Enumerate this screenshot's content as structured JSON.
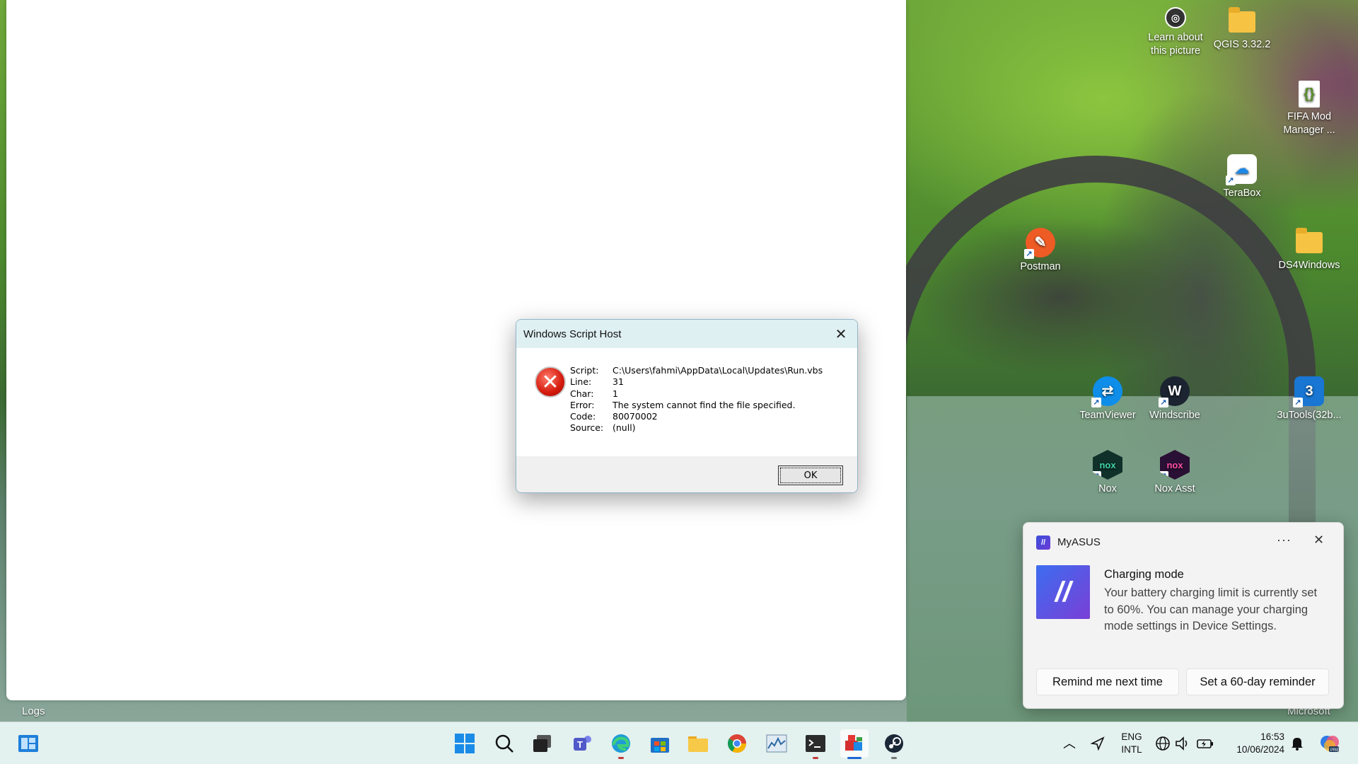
{
  "app_window": {
    "bottom_label": "Logs",
    "right_label": "Microsoft"
  },
  "desktop_icons": [
    {
      "label": "Learn about this picture",
      "icon": "camera-icon"
    },
    {
      "label": "QGIS 3.32.2",
      "icon": "folder-icon"
    },
    {
      "label": "FIFA Mod Manager ...",
      "icon": "json-file-icon"
    },
    {
      "label": "TeraBox",
      "icon": "cloud-icon"
    },
    {
      "label": "Postman",
      "icon": "postman-icon"
    },
    {
      "label": "DS4Windows",
      "icon": "folder-icon"
    },
    {
      "label": "TeamViewer",
      "icon": "teamviewer-icon"
    },
    {
      "label": "Windscribe",
      "icon": "windscribe-icon"
    },
    {
      "label": "3uTools(32b...",
      "icon": "3utools-icon"
    },
    {
      "label": "Nox",
      "icon": "nox-icon"
    },
    {
      "label": "Nox Asst",
      "icon": "nox-icon"
    }
  ],
  "dialog": {
    "title": "Windows Script Host",
    "rows": [
      {
        "key": "Script:",
        "value": "C:\\Users\\fahmi\\AppData\\Local\\Updates\\Run.vbs"
      },
      {
        "key": "Line:",
        "value": "31"
      },
      {
        "key": "Char:",
        "value": "1"
      },
      {
        "key": "Error:",
        "value": "The system cannot find the file specified."
      },
      {
        "key": "Code:",
        "value": "80070002"
      },
      {
        "key": "Source:",
        "value": "(null)"
      }
    ],
    "ok_label": "OK"
  },
  "toast": {
    "app_name": "MyASUS",
    "more_label": "···",
    "heading": "Charging mode",
    "text": "Your battery charging limit is currently set to 60%. You can manage your charging mode settings in Device Settings.",
    "button_remind": "Remind me next time",
    "button_reminder": "Set a 60-day reminder"
  },
  "taskbar": {
    "apps": [
      "widgets-icon",
      "start-icon",
      "search-icon",
      "task-view-icon",
      "teams-icon",
      "edge-icon",
      "store-icon",
      "file-explorer-icon",
      "chrome-icon",
      "resource-monitor-icon",
      "terminal-icon",
      "script-host-icon",
      "steam-icon"
    ],
    "language_line1": "ENG",
    "language_line2": "INTL",
    "time": "16:53",
    "date": "10/06/2024"
  }
}
